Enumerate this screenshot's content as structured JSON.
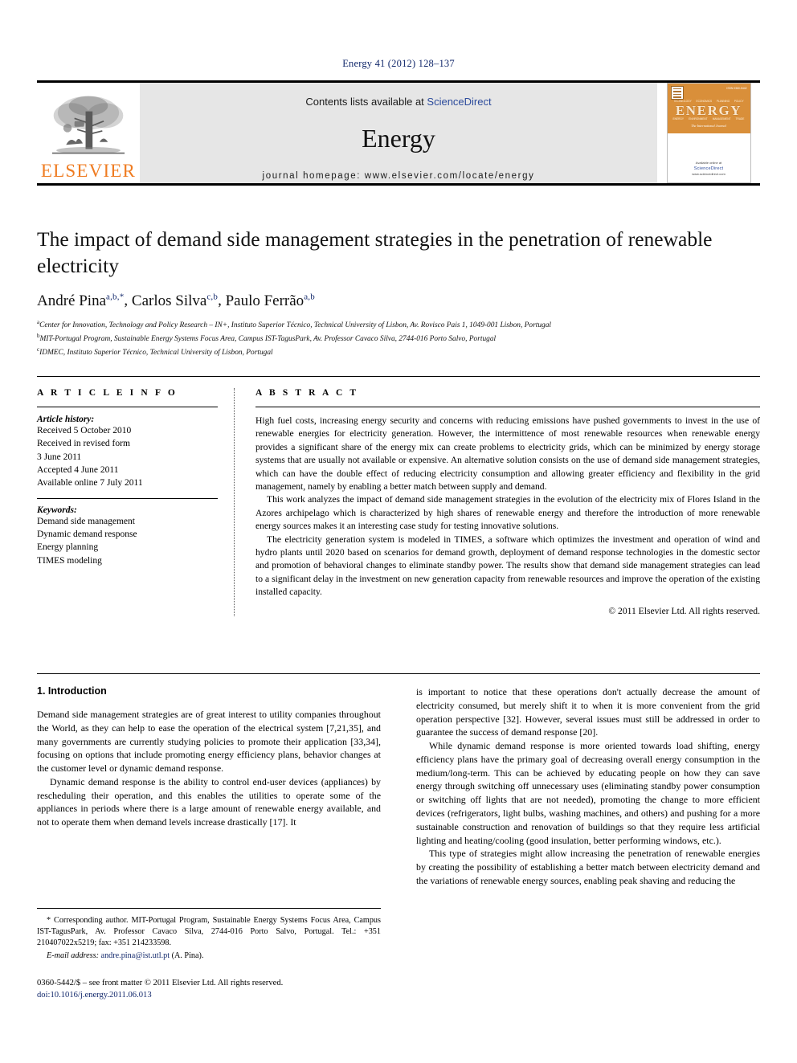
{
  "running_head": "Energy 41 (2012) 128–137",
  "masthead": {
    "publisher_logo_name": "ELSEVIER",
    "contents_prefix": "Contents lists available at ",
    "contents_link": "ScienceDirect",
    "journal_name": "Energy",
    "homepage": "journal homepage: www.elsevier.com/locate/energy",
    "cover": {
      "title": "ENERGY",
      "subtitle": "The International Journal",
      "issn": "ISSN 0360-5442",
      "top_words": [
        "TECHNOLOGY",
        "ECONOMICS",
        "PLANNING",
        "POLICY"
      ],
      "bottom_words": [
        "ENERGY",
        "ENVIRONMENT",
        "MANAGEMENT",
        "TRADE"
      ],
      "sd_prefix": "Available online at",
      "sd_brand": "ScienceDirect",
      "sd_url": "www.sciencedirect.com"
    }
  },
  "article": {
    "title": "The impact of demand side management strategies in the penetration of renewable electricity",
    "authors": [
      {
        "name": "André Pina",
        "sup": "a,b,*"
      },
      {
        "name": "Carlos Silva",
        "sup": "c,b"
      },
      {
        "name": "Paulo Ferrão",
        "sup": "a,b"
      }
    ],
    "affiliations": [
      {
        "mark": "a",
        "text": "Center for Innovation, Technology and Policy Research – IN+, Instituto Superior Técnico, Technical University of Lisbon, Av. Rovisco Pais 1, 1049-001 Lisbon, Portugal"
      },
      {
        "mark": "b",
        "text": "MIT-Portugal Program, Sustainable Energy Systems Focus Area, Campus IST-TagusPark, Av. Professor Cavaco Silva, 2744-016 Porto Salvo, Portugal"
      },
      {
        "mark": "c",
        "text": "IDMEC, Instituto Superior Técnico, Technical University of Lisbon, Portugal"
      }
    ]
  },
  "article_info": {
    "heading": "A R T I C L E  I N F O",
    "history_label": "Article history:",
    "history": [
      "Received 5 October 2010",
      "Received in revised form",
      "3 June 2011",
      "Accepted 4 June 2011",
      "Available online 7 July 2011"
    ],
    "keywords_label": "Keywords:",
    "keywords": [
      "Demand side management",
      "Dynamic demand response",
      "Energy planning",
      "TIMES modeling"
    ]
  },
  "abstract": {
    "heading": "A B S T R A C T",
    "paragraphs": [
      "High fuel costs, increasing energy security and concerns with reducing emissions have pushed governments to invest in the use of renewable energies for electricity generation. However, the intermittence of most renewable resources when renewable energy provides a significant share of the energy mix can create problems to electricity grids, which can be minimized by energy storage systems that are usually not available or expensive. An alternative solution consists on the use of demand side management strategies, which can have the double effect of reducing electricity consumption and allowing greater efficiency and flexibility in the grid management, namely by enabling a better match between supply and demand.",
      "This work analyzes the impact of demand side management strategies in the evolution of the electricity mix of Flores Island in the Azores archipelago which is characterized by high shares of renewable energy and therefore the introduction of more renewable energy sources makes it an interesting case study for testing innovative solutions.",
      "The electricity generation system is modeled in TIMES, a software which optimizes the investment and operation of wind and hydro plants until 2020 based on scenarios for demand growth, deployment of demand response technologies in the domestic sector and promotion of behavioral changes to eliminate standby power. The results show that demand side management strategies can lead to a significant delay in the investment on new generation capacity from renewable resources and improve the operation of the existing installed capacity."
    ],
    "copyright": "© 2011 Elsevier Ltd. All rights reserved."
  },
  "body": {
    "section_number_title": "1. Introduction",
    "left_paragraphs": [
      "Demand side management strategies are of great interest to utility companies throughout the World, as they can help to ease the operation of the electrical system [7,21,35], and many governments are currently studying policies to promote their application [33,34], focusing on options that include promoting energy efficiency plans, behavior changes at the customer level or dynamic demand response.",
      "Dynamic demand response is the ability to control end-user devices (appliances) by rescheduling their operation, and this enables the utilities to operate some of the appliances in periods where there is a large amount of renewable energy available, and not to operate them when demand levels increase drastically [17]. It"
    ],
    "right_paragraphs": [
      "is important to notice that these operations don't actually decrease the amount of electricity consumed, but merely shift it to when it is more convenient from the grid operation perspective [32]. However, several issues must still be addressed in order to guarantee the success of demand response [20].",
      "While dynamic demand response is more oriented towards load shifting, energy efficiency plans have the primary goal of decreasing overall energy consumption in the medium/long-term. This can be achieved by educating people on how they can save energy through switching off unnecessary uses (eliminating standby power consumption or switching off lights that are not needed), promoting the change to more efficient devices (refrigerators, light bulbs, washing machines, and others) and pushing for a more sustainable construction and renovation of buildings so that they require less artificial lighting and heating/cooling (good insulation, better performing windows, etc.).",
      "This type of strategies might allow increasing the penetration of renewable energies by creating the possibility of establishing a better match between electricity demand and the variations of renewable energy sources, enabling peak shaving and reducing the"
    ]
  },
  "footnote": {
    "corresponding": "* Corresponding author. MIT-Portugal Program, Sustainable Energy Systems Focus Area, Campus IST-TagusPark, Av. Professor Cavaco Silva, 2744-016 Porto Salvo, Portugal. Tel.: +351 210407022x5219; fax: +351 214233598.",
    "email_label": "E-mail address:",
    "email": "andre.pina@ist.utl.pt",
    "email_owner": "(A. Pina)."
  },
  "imprint": {
    "front_matter": "0360-5442/$ – see front matter © 2011 Elsevier Ltd. All rights reserved.",
    "doi_label": "doi:",
    "doi": "10.1016/j.energy.2011.06.013"
  },
  "colors": {
    "link_blue": "#12286b",
    "sciencedirect_blue": "#2b4a9b",
    "elsevier_orange": "#ef7c22",
    "cover_orange": "#d98f3a",
    "masthead_grey": "#e6e6e6"
  }
}
